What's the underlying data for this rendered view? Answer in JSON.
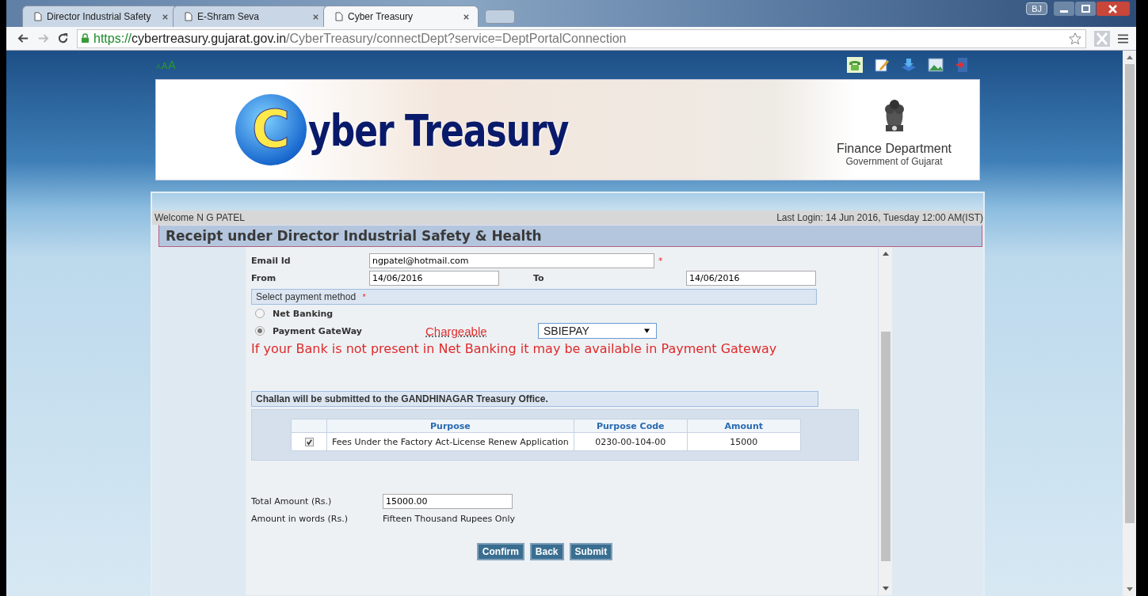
{
  "browser": {
    "tabs": [
      {
        "label": "Director Industrial Safety",
        "selected": false
      },
      {
        "label": "E-Shram Seva",
        "selected": false
      },
      {
        "label": "Cyber Treasury",
        "selected": true
      }
    ],
    "profile": "BJ",
    "url": {
      "scheme": "https://",
      "host": "cybertreasury.gujarat.gov.in",
      "path": "/CyberTreasury/connectDept?service=DeptPortalConnection"
    }
  },
  "header": {
    "font_sizes": [
      "A",
      "A",
      "A"
    ],
    "logo_initial": "C",
    "logo_rest": "yber Treasury",
    "department": "Finance Department",
    "government": "Government of Gujarat"
  },
  "welcome": "Welcome N G PATEL",
  "last_login": "Last Login: 14 Jun 2016, Tuesday 12:00 AM(IST)",
  "title": "Receipt under Director Industrial Safety & Health",
  "form": {
    "email_label": "Email Id",
    "email": "ngpatel@hotmail.com",
    "required_mark": "*",
    "from_label": "From",
    "from": "14/06/2016",
    "to_label": "To",
    "to": "14/06/2016",
    "payment_heading": "Select payment method",
    "payment_required_mark": "*",
    "methods": [
      {
        "label": "Net Banking",
        "selected": false
      },
      {
        "label": "Payment GateWay",
        "selected": true
      }
    ],
    "chargeable": "Chargeable",
    "gateway": "SBIEPAY",
    "notice": "If your Bank is not present in Net Banking it may be available in Payment Gateway",
    "challan_note": "Challan will be submitted to the GANDHINAGAR Treasury Office.",
    "table": {
      "columns": [
        "Purpose",
        "Purpose Code",
        "Amount"
      ],
      "rows": [
        {
          "checked": true,
          "purpose": "Fees Under the Factory Act-License Renew Application",
          "code": "0230-00-104-00",
          "amount": "15000"
        }
      ]
    },
    "total_label": "Total Amount (Rs.)",
    "total": "15000.00",
    "words_label": "Amount in words (Rs.)",
    "words": "Fifteen Thousand Rupees Only",
    "buttons": [
      "Confirm",
      "Back",
      "Submit"
    ]
  }
}
